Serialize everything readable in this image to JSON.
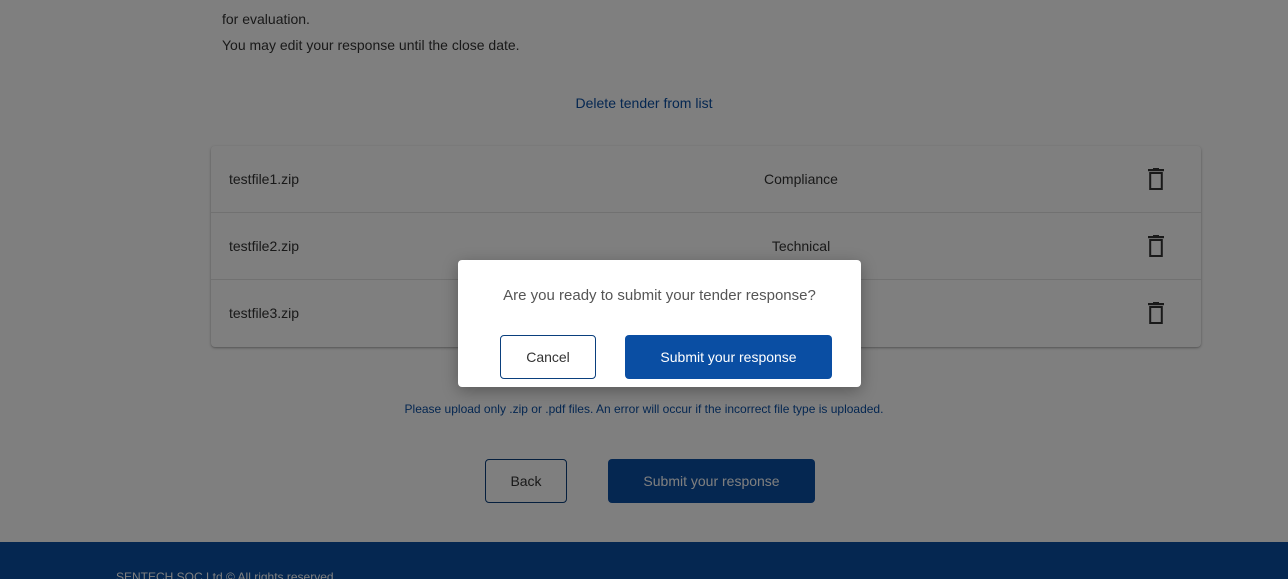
{
  "intro": {
    "line1": "for evaluation.",
    "line2": "You may edit your response until the close date."
  },
  "delete_link": "Delete tender from list",
  "files": [
    {
      "name": "testfile1.zip",
      "category": "Compliance",
      "icon": "trash-icon"
    },
    {
      "name": "testfile2.zip",
      "category": "Technical",
      "icon": "trash-icon"
    },
    {
      "name": "testfile3.zip",
      "category": "",
      "icon": "trash-icon"
    }
  ],
  "upload_note": "Please upload only .zip or .pdf files. An error will occur if the incorrect file type is uploaded.",
  "actions": {
    "back_label": "Back",
    "submit_label": "Submit your response"
  },
  "footer": {
    "text": "SENTECH SOC Ltd © All rights reserved"
  },
  "dialog": {
    "question": "Are you ready to submit your tender response?",
    "cancel_label": "Cancel",
    "submit_label": "Submit your response"
  },
  "colors": {
    "primary": "#0a4ea3",
    "overlay": "rgba(0,0,0,0.5)"
  }
}
